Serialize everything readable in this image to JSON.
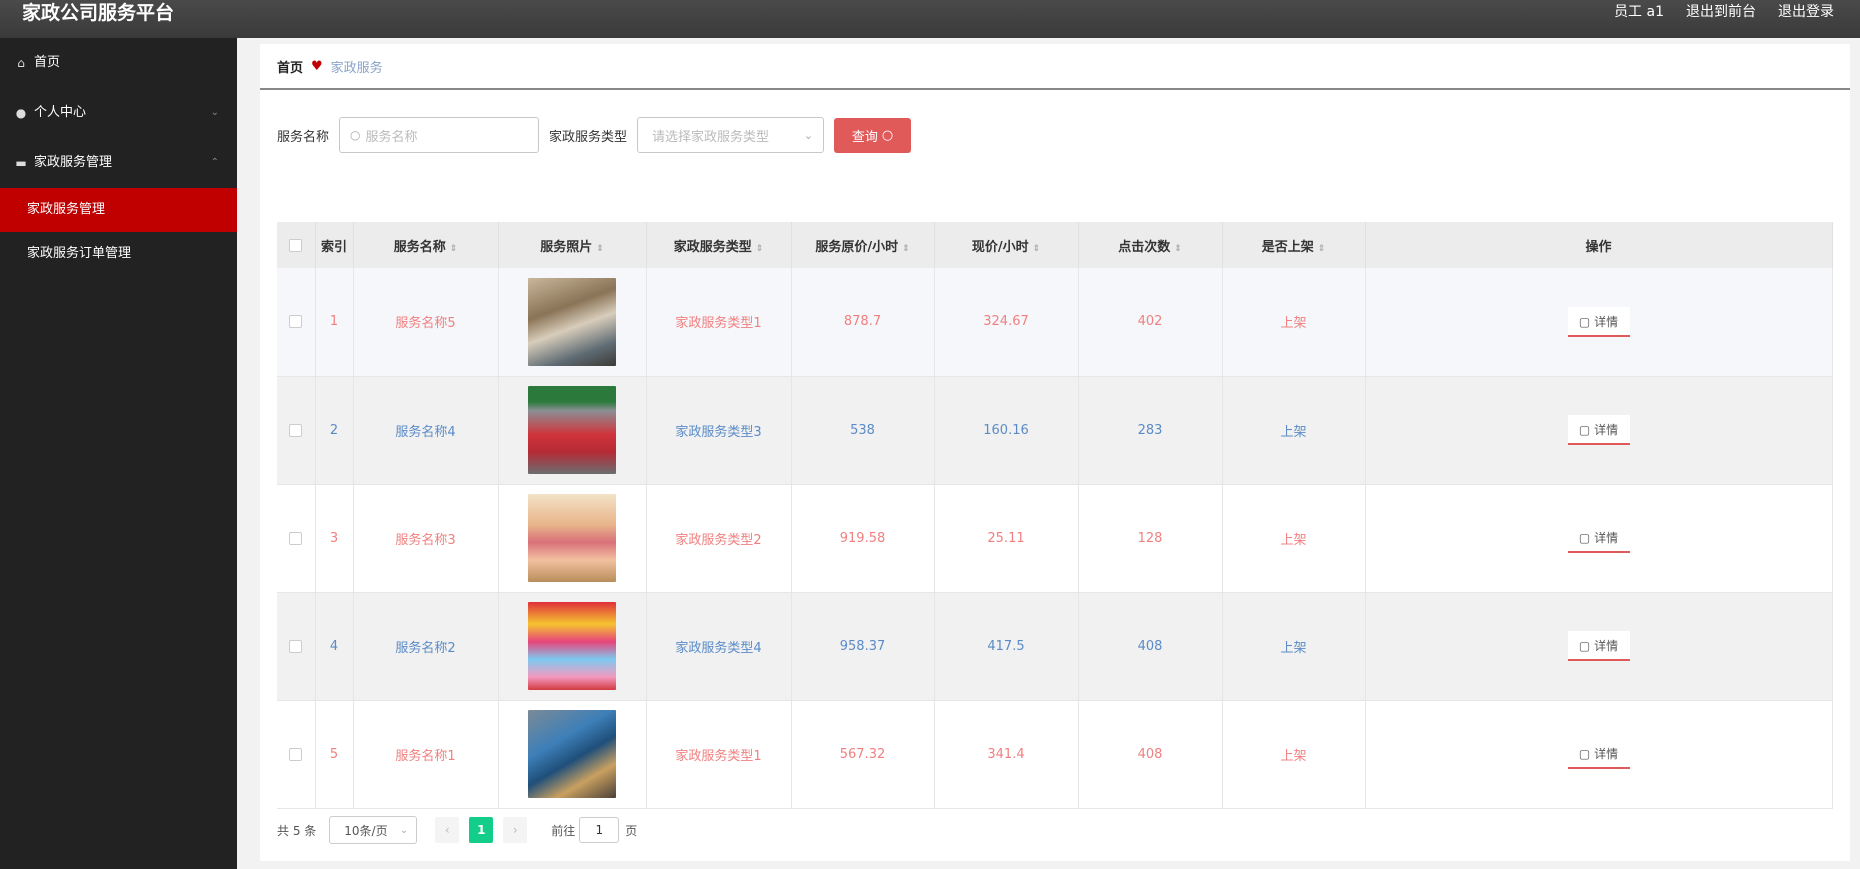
{
  "header": {
    "title": "家政公司服务平台",
    "user": "员工 a1",
    "back_to_front": "退出到前台",
    "logout": "退出登录"
  },
  "sidebar": {
    "items": [
      {
        "label": "首页",
        "icon": "home-icon"
      },
      {
        "label": "个人中心",
        "icon": "user-icon",
        "arrow": "chevron-down-icon"
      },
      {
        "label": "家政服务管理",
        "icon": "stack-icon",
        "arrow": "chevron-up-icon"
      }
    ],
    "subitems": [
      {
        "label": "家政服务管理",
        "active": true
      },
      {
        "label": "家政服务订单管理",
        "active": false
      }
    ]
  },
  "breadcrumb": {
    "home": "首页",
    "current": "家政服务"
  },
  "filter": {
    "name_label": "服务名称",
    "name_placeholder": "服务名称",
    "type_label": "家政服务类型",
    "type_placeholder": "请选择家政服务类型",
    "search_button": "查询"
  },
  "table": {
    "headers": [
      "索引",
      "服务名称",
      "服务照片",
      "家政服务类型",
      "服务原价/小时",
      "现价/小时",
      "点击次数",
      "是否上架",
      "操作"
    ],
    "detail_label": "详情",
    "rows": [
      {
        "index": "1",
        "name": "服务名称5",
        "type": "家政服务类型1",
        "orig_price": "878.7",
        "price": "324.67",
        "clicks": "402",
        "status": "上架"
      },
      {
        "index": "2",
        "name": "服务名称4",
        "type": "家政服务类型3",
        "orig_price": "538",
        "price": "160.16",
        "clicks": "283",
        "status": "上架"
      },
      {
        "index": "3",
        "name": "服务名称3",
        "type": "家政服务类型2",
        "orig_price": "919.58",
        "price": "25.11",
        "clicks": "128",
        "status": "上架"
      },
      {
        "index": "4",
        "name": "服务名称2",
        "type": "家政服务类型4",
        "orig_price": "958.37",
        "price": "417.5",
        "clicks": "408",
        "status": "上架"
      },
      {
        "index": "5",
        "name": "服务名称1",
        "type": "家政服务类型1",
        "orig_price": "567.32",
        "price": "341.4",
        "clicks": "408",
        "status": "上架"
      }
    ]
  },
  "pager": {
    "total": "共 5 条",
    "page_size": "10条/页",
    "current_page": "1",
    "goto_prefix": "前往",
    "goto_value": "1",
    "goto_suffix": "页"
  },
  "colors": {
    "accent_red": "#c00000",
    "button_red": "#e05a5a",
    "pager_active": "#13ce8a",
    "text_red": "#f08080",
    "text_blue": "#5b8bc7"
  }
}
